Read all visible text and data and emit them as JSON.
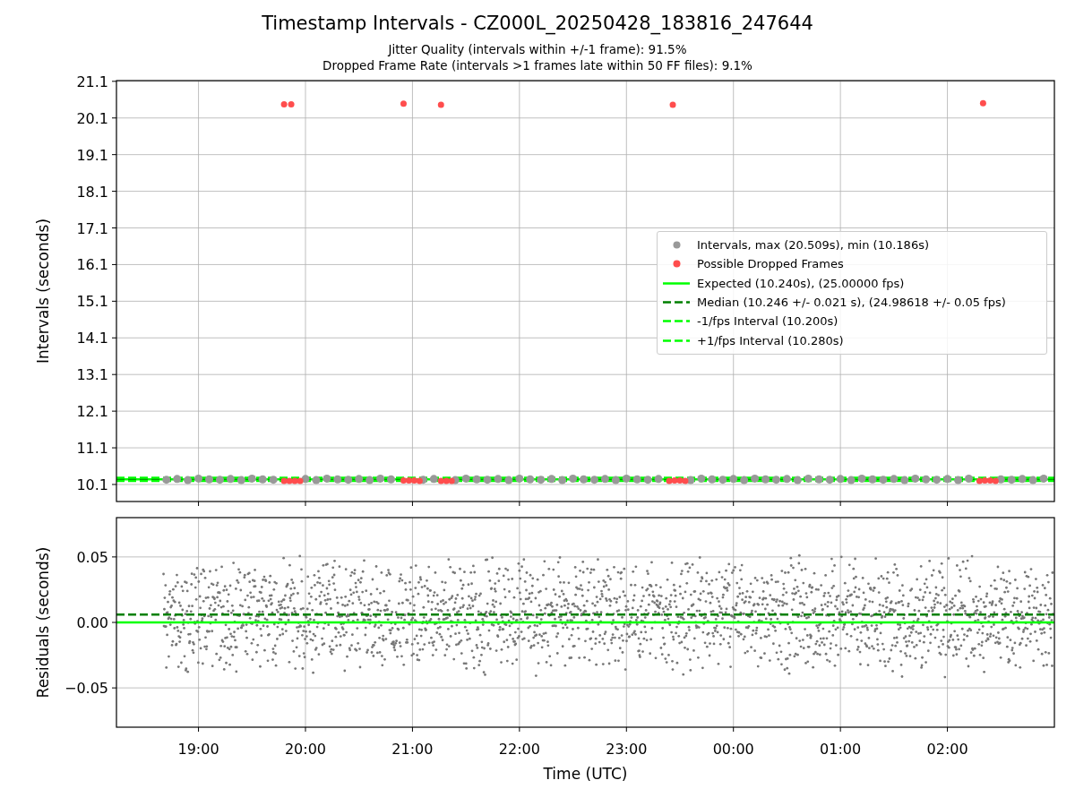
{
  "title": "Timestamp Intervals - CZ000L_20250428_183816_247644",
  "subtitles": [
    "Jitter Quality (intervals within +/-1 frame): 91.5%",
    "Dropped Frame Rate (intervals >1 frames late within 50 FF files): 9.1%"
  ],
  "intervals_plot": {
    "chart_data": {
      "type": "scatter",
      "ylabel": "Intervals (seconds)",
      "xlim": [
        "2025-04-28T18:14",
        "2025-04-29T03:00"
      ],
      "ylim": [
        9.635,
        21.12
      ],
      "yticks": [
        {
          "value": 10.1,
          "label": "10.1"
        },
        {
          "value": 11.1,
          "label": "11.1"
        },
        {
          "value": 12.1,
          "label": "12.1"
        },
        {
          "value": 13.1,
          "label": "13.1"
        },
        {
          "value": 14.1,
          "label": "14.1"
        },
        {
          "value": 15.1,
          "label": "15.1"
        },
        {
          "value": 16.1,
          "label": "16.1"
        },
        {
          "value": 17.1,
          "label": "17.1"
        },
        {
          "value": 18.1,
          "label": "18.1"
        },
        {
          "value": 19.1,
          "label": "19.1"
        },
        {
          "value": 20.1,
          "label": "20.1"
        },
        {
          "value": 21.1,
          "label": "21.1"
        }
      ],
      "series": [
        {
          "name": "Intervals, max (20.509s), min (10.186s)",
          "color": "#999999",
          "x": [
            "2025-04-28T18:42",
            "2025-04-28T18:48",
            "2025-04-28T18:54",
            "2025-04-28T19:00",
            "2025-04-28T19:06",
            "2025-04-28T19:12",
            "2025-04-28T19:18",
            "2025-04-28T19:24",
            "2025-04-28T19:30",
            "2025-04-28T19:36",
            "2025-04-28T19:42",
            "2025-04-28T20:00",
            "2025-04-28T20:06",
            "2025-04-28T20:12",
            "2025-04-28T20:18",
            "2025-04-28T20:24",
            "2025-04-28T20:30",
            "2025-04-28T20:36",
            "2025-04-28T20:42",
            "2025-04-28T20:48",
            "2025-04-28T21:06",
            "2025-04-28T21:12",
            "2025-04-28T21:24",
            "2025-04-28T21:30",
            "2025-04-28T21:36",
            "2025-04-28T21:42",
            "2025-04-28T21:48",
            "2025-04-28T21:54",
            "2025-04-28T22:00",
            "2025-04-28T22:06",
            "2025-04-28T22:12",
            "2025-04-28T22:18",
            "2025-04-28T22:24",
            "2025-04-28T22:30",
            "2025-04-28T22:36",
            "2025-04-28T22:42",
            "2025-04-28T22:48",
            "2025-04-28T22:54",
            "2025-04-28T23:00",
            "2025-04-28T23:06",
            "2025-04-28T23:12",
            "2025-04-28T23:18",
            "2025-04-28T23:36",
            "2025-04-28T23:42",
            "2025-04-28T23:48",
            "2025-04-28T23:54",
            "2025-04-29T00:00",
            "2025-04-29T00:06",
            "2025-04-29T00:12",
            "2025-04-29T00:18",
            "2025-04-29T00:24",
            "2025-04-29T00:30",
            "2025-04-29T00:36",
            "2025-04-29T00:42",
            "2025-04-29T00:48",
            "2025-04-29T00:54",
            "2025-04-29T01:00",
            "2025-04-29T01:06",
            "2025-04-29T01:12",
            "2025-04-29T01:18",
            "2025-04-29T01:24",
            "2025-04-29T01:30",
            "2025-04-29T01:36",
            "2025-04-29T01:42",
            "2025-04-29T01:48",
            "2025-04-29T01:54",
            "2025-04-29T02:00",
            "2025-04-29T02:06",
            "2025-04-29T02:12",
            "2025-04-29T02:30",
            "2025-04-29T02:36",
            "2025-04-29T02:42",
            "2025-04-29T02:48",
            "2025-04-29T02:54"
          ],
          "values": [
            10.23,
            10.25,
            10.22,
            10.26,
            10.24,
            10.23,
            10.25,
            10.22,
            10.26,
            10.24,
            10.23,
            10.25,
            10.22,
            10.26,
            10.24,
            10.23,
            10.25,
            10.22,
            10.26,
            10.24,
            10.23,
            10.25,
            10.22,
            10.26,
            10.24,
            10.23,
            10.25,
            10.22,
            10.26,
            10.24,
            10.23,
            10.25,
            10.22,
            10.26,
            10.24,
            10.23,
            10.25,
            10.22,
            10.26,
            10.24,
            10.23,
            10.25,
            10.22,
            10.26,
            10.24,
            10.23,
            10.25,
            10.22,
            10.26,
            10.24,
            10.23,
            10.25,
            10.22,
            10.26,
            10.24,
            10.23,
            10.25,
            10.22,
            10.26,
            10.24,
            10.23,
            10.25,
            10.22,
            10.26,
            10.24,
            10.23,
            10.25,
            10.22,
            10.26,
            10.24,
            10.23,
            10.25,
            10.22,
            10.26
          ]
        },
        {
          "name": "Possible Dropped Frames",
          "color": "#ff4d4d",
          "x": [
            "2025-04-28T19:48",
            "2025-04-28T19:52",
            "2025-04-28T20:55",
            "2025-04-28T21:16",
            "2025-04-28T23:26",
            "2025-04-29T02:20",
            "2025-04-28T19:48",
            "2025-04-28T19:51",
            "2025-04-28T19:54",
            "2025-04-28T19:57",
            "2025-04-28T20:55",
            "2025-04-28T20:58",
            "2025-04-28T21:01",
            "2025-04-28T21:04",
            "2025-04-28T21:16",
            "2025-04-28T21:19",
            "2025-04-28T21:22",
            "2025-04-28T23:24",
            "2025-04-28T23:27",
            "2025-04-28T23:30",
            "2025-04-28T23:33",
            "2025-04-29T02:18",
            "2025-04-29T02:21",
            "2025-04-29T02:24",
            "2025-04-29T02:27"
          ],
          "values": [
            20.47,
            20.47,
            20.49,
            20.46,
            20.46,
            20.5,
            10.2,
            10.2,
            10.2,
            10.2,
            10.21,
            10.21,
            10.21,
            10.2,
            10.2,
            10.2,
            10.2,
            10.2,
            10.21,
            10.21,
            10.2,
            10.2,
            10.21,
            10.21,
            10.2
          ]
        }
      ],
      "ref_lines": [
        {
          "axis": "y",
          "value": 10.24,
          "label": "Expected (10.240s), (25.00000 fps)",
          "color": "#00ff00"
        },
        {
          "axis": "y",
          "value": 10.246,
          "label": "Median (10.246 +/- 0.021 s), (24.98618 +/- 0.05 fps)",
          "color": "#008000"
        },
        {
          "axis": "y",
          "value": 10.2,
          "label": "-1/fps Interval (10.200s)",
          "color": "#00ff00"
        },
        {
          "axis": "y",
          "value": 10.28,
          "label": "+1/fps Interval (10.280s)",
          "color": "#00ff00"
        }
      ],
      "grid": true
    }
  },
  "residuals_plot": {
    "chart_data": {
      "type": "scatter",
      "xlabel": "Time (UTC)",
      "ylabel": "Residuals (seconds)",
      "xlim": [
        "2025-04-28T18:14",
        "2025-04-29T03:00"
      ],
      "ylim": [
        -0.08,
        0.08
      ],
      "xticks": [
        {
          "value": "2025-04-28T19:00",
          "label": "19:00"
        },
        {
          "value": "2025-04-28T20:00",
          "label": "20:00"
        },
        {
          "value": "2025-04-28T21:00",
          "label": "21:00"
        },
        {
          "value": "2025-04-28T22:00",
          "label": "22:00"
        },
        {
          "value": "2025-04-28T23:00",
          "label": "23:00"
        },
        {
          "value": "2025-04-29T00:00",
          "label": "00:00"
        },
        {
          "value": "2025-04-29T01:00",
          "label": "01:00"
        },
        {
          "value": "2025-04-29T02:00",
          "label": "02:00"
        }
      ],
      "yticks": [
        {
          "value": -0.05,
          "label": "−0.05"
        },
        {
          "value": 0,
          "label": "0.00"
        },
        {
          "value": 0.05,
          "label": "0.05"
        }
      ],
      "ref_lines": [
        {
          "axis": "y",
          "value": 0,
          "color": "#00ff00"
        },
        {
          "axis": "y",
          "value": 0.006,
          "color": "#008000"
        }
      ],
      "grid": true
    }
  }
}
